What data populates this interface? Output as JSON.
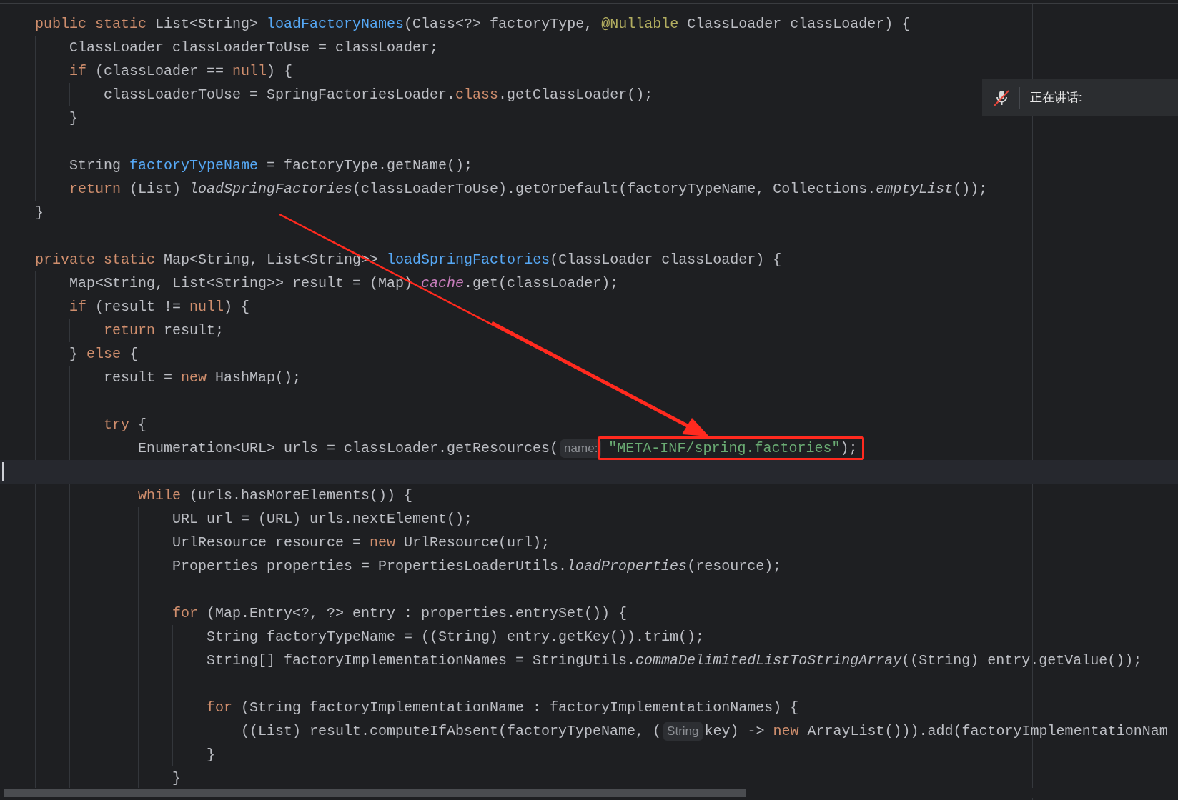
{
  "editor": {
    "lines": [
      {
        "kind": "code",
        "tokens": [
          {
            "kind": "kw",
            "text": "public static "
          },
          {
            "kind": "id",
            "text": "List<String> "
          },
          {
            "kind": "fn",
            "text": "loadFactoryNames"
          },
          {
            "kind": "id",
            "text": "(Class<?> factoryType, "
          },
          {
            "kind": "ann",
            "text": "@Nullable"
          },
          {
            "kind": "id",
            "text": " ClassLoader classLoader) {"
          }
        ],
        "children": [
          {
            "kind": "code",
            "tokens": [
              {
                "kind": "id",
                "text": "ClassLoader classLoaderToUse = classLoader;"
              }
            ]
          },
          {
            "kind": "code",
            "tokens": [
              {
                "kind": "kw",
                "text": "if"
              },
              {
                "kind": "id",
                "text": " (classLoader == "
              },
              {
                "kind": "kw",
                "text": "null"
              },
              {
                "kind": "id",
                "text": ") {"
              }
            ],
            "children": [
              {
                "kind": "code",
                "tokens": [
                  {
                    "kind": "id",
                    "text": "classLoaderToUse = SpringFactoriesLoader."
                  },
                  {
                    "kind": "kw",
                    "text": "class"
                  },
                  {
                    "kind": "id",
                    "text": ".getClassLoader();"
                  }
                ]
              }
            ]
          },
          {
            "kind": "code",
            "tokens": [
              {
                "kind": "id",
                "text": "}"
              }
            ]
          },
          {
            "kind": "blank"
          },
          {
            "kind": "code",
            "tokens": [
              {
                "kind": "id",
                "text": "String "
              },
              {
                "kind": "fn",
                "text": "factoryTypeName"
              },
              {
                "kind": "id",
                "text": " = factoryType.getName();"
              }
            ]
          },
          {
            "kind": "code",
            "tokens": [
              {
                "kind": "kw",
                "text": "return"
              },
              {
                "kind": "id",
                "text": " (List) "
              },
              {
                "kind": "call",
                "text": "loadSpringFactories"
              },
              {
                "kind": "id",
                "text": "(classLoaderToUse).getOrDefault(factoryTypeName, Collections."
              },
              {
                "kind": "call",
                "text": "emptyList"
              },
              {
                "kind": "id",
                "text": "());"
              }
            ]
          }
        ]
      },
      {
        "kind": "code",
        "tokens": [
          {
            "kind": "id",
            "text": "}"
          }
        ]
      },
      {
        "kind": "blank"
      },
      {
        "kind": "code",
        "tokens": [
          {
            "kind": "kw",
            "text": "private static "
          },
          {
            "kind": "id",
            "text": "Map<String, List<String>> "
          },
          {
            "kind": "fn",
            "text": "loadSpringFactories"
          },
          {
            "kind": "id",
            "text": "(ClassLoader classLoader) {"
          }
        ],
        "children": [
          {
            "kind": "code",
            "tokens": [
              {
                "kind": "id",
                "text": "Map<String, List<String>> result = (Map) "
              },
              {
                "kind": "field",
                "text": "cache"
              },
              {
                "kind": "id",
                "text": ".get(classLoader);"
              }
            ]
          },
          {
            "kind": "code",
            "tokens": [
              {
                "kind": "kw",
                "text": "if"
              },
              {
                "kind": "id",
                "text": " (result != "
              },
              {
                "kind": "kw",
                "text": "null"
              },
              {
                "kind": "id",
                "text": ") {"
              }
            ],
            "children": [
              {
                "kind": "code",
                "tokens": [
                  {
                    "kind": "kw",
                    "text": "return"
                  },
                  {
                    "kind": "id",
                    "text": " result;"
                  }
                ]
              }
            ]
          },
          {
            "kind": "code",
            "tokens": [
              {
                "kind": "id",
                "text": "} "
              },
              {
                "kind": "kw",
                "text": "else"
              },
              {
                "kind": "id",
                "text": " {"
              }
            ],
            "children": [
              {
                "kind": "code",
                "tokens": [
                  {
                    "kind": "id",
                    "text": "result = "
                  },
                  {
                    "kind": "kw",
                    "text": "new"
                  },
                  {
                    "kind": "id",
                    "text": " HashMap();"
                  }
                ]
              },
              {
                "kind": "blank"
              },
              {
                "kind": "code",
                "tokens": [
                  {
                    "kind": "kw",
                    "text": "try"
                  },
                  {
                    "kind": "id",
                    "text": " {"
                  }
                ],
                "children": [
                  {
                    "kind": "code",
                    "tokens": [
                      {
                        "kind": "id",
                        "text": "Enumeration<URL> urls = classLoader.getResources("
                      },
                      {
                        "kind": "hint",
                        "text": "name:"
                      }
                    ],
                    "highlighted": [
                      {
                        "kind": "str",
                        "text": "\"META-INF/spring.factories\""
                      },
                      {
                        "kind": "id",
                        "text": ");"
                      }
                    ]
                  },
                  {
                    "kind": "caret"
                  },
                  {
                    "kind": "code",
                    "tokens": [
                      {
                        "kind": "kw",
                        "text": "while"
                      },
                      {
                        "kind": "id",
                        "text": " (urls.hasMoreElements()) {"
                      }
                    ],
                    "children": [
                      {
                        "kind": "code",
                        "tokens": [
                          {
                            "kind": "id",
                            "text": "URL url = (URL) urls.nextElement();"
                          }
                        ]
                      },
                      {
                        "kind": "code",
                        "tokens": [
                          {
                            "kind": "id",
                            "text": "UrlResource resource = "
                          },
                          {
                            "kind": "kw",
                            "text": "new"
                          },
                          {
                            "kind": "id",
                            "text": " UrlResource(url);"
                          }
                        ]
                      },
                      {
                        "kind": "code",
                        "tokens": [
                          {
                            "kind": "id",
                            "text": "Properties properties = PropertiesLoaderUtils."
                          },
                          {
                            "kind": "call",
                            "text": "loadProperties"
                          },
                          {
                            "kind": "id",
                            "text": "(resource);"
                          }
                        ]
                      },
                      {
                        "kind": "blank"
                      },
                      {
                        "kind": "code",
                        "tokens": [
                          {
                            "kind": "kw",
                            "text": "for"
                          },
                          {
                            "kind": "id",
                            "text": " (Map.Entry<?, ?> entry : properties.entrySet()) {"
                          }
                        ],
                        "children": [
                          {
                            "kind": "code",
                            "tokens": [
                              {
                                "kind": "id",
                                "text": "String factoryTypeName = ((String) entry.getKey()).trim();"
                              }
                            ]
                          },
                          {
                            "kind": "code",
                            "tokens": [
                              {
                                "kind": "id",
                                "text": "String[] factoryImplementationNames = StringUtils."
                              },
                              {
                                "kind": "call",
                                "text": "commaDelimitedListToStringArray"
                              },
                              {
                                "kind": "id",
                                "text": "((String) entry.getValue());"
                              }
                            ]
                          },
                          {
                            "kind": "blank"
                          },
                          {
                            "kind": "code",
                            "tokens": [
                              {
                                "kind": "kw",
                                "text": "for"
                              },
                              {
                                "kind": "id",
                                "text": " (String factoryImplementationName : factoryImplementationNames) {"
                              }
                            ],
                            "children": [
                              {
                                "kind": "code",
                                "tokens": [
                                  {
                                    "kind": "id",
                                    "text": "((List) result.computeIfAbsent(factoryTypeName, ("
                                  },
                                  {
                                    "kind": "hint",
                                    "text": "String"
                                  },
                                  {
                                    "kind": "id",
                                    "text": "key) -> "
                                  },
                                  {
                                    "kind": "kw",
                                    "text": "new"
                                  },
                                  {
                                    "kind": "id",
                                    "text": " ArrayList())).add(factoryImplementationNam"
                                  }
                                ]
                              }
                            ]
                          },
                          {
                            "kind": "code",
                            "tokens": [
                              {
                                "kind": "id",
                                "text": "}"
                              }
                            ]
                          }
                        ]
                      },
                      {
                        "kind": "code",
                        "tokens": [
                          {
                            "kind": "id",
                            "text": "}"
                          }
                        ]
                      }
                    ]
                  }
                ]
              }
            ]
          }
        ]
      }
    ]
  },
  "speaking_popup": {
    "label": "正在讲话:"
  }
}
